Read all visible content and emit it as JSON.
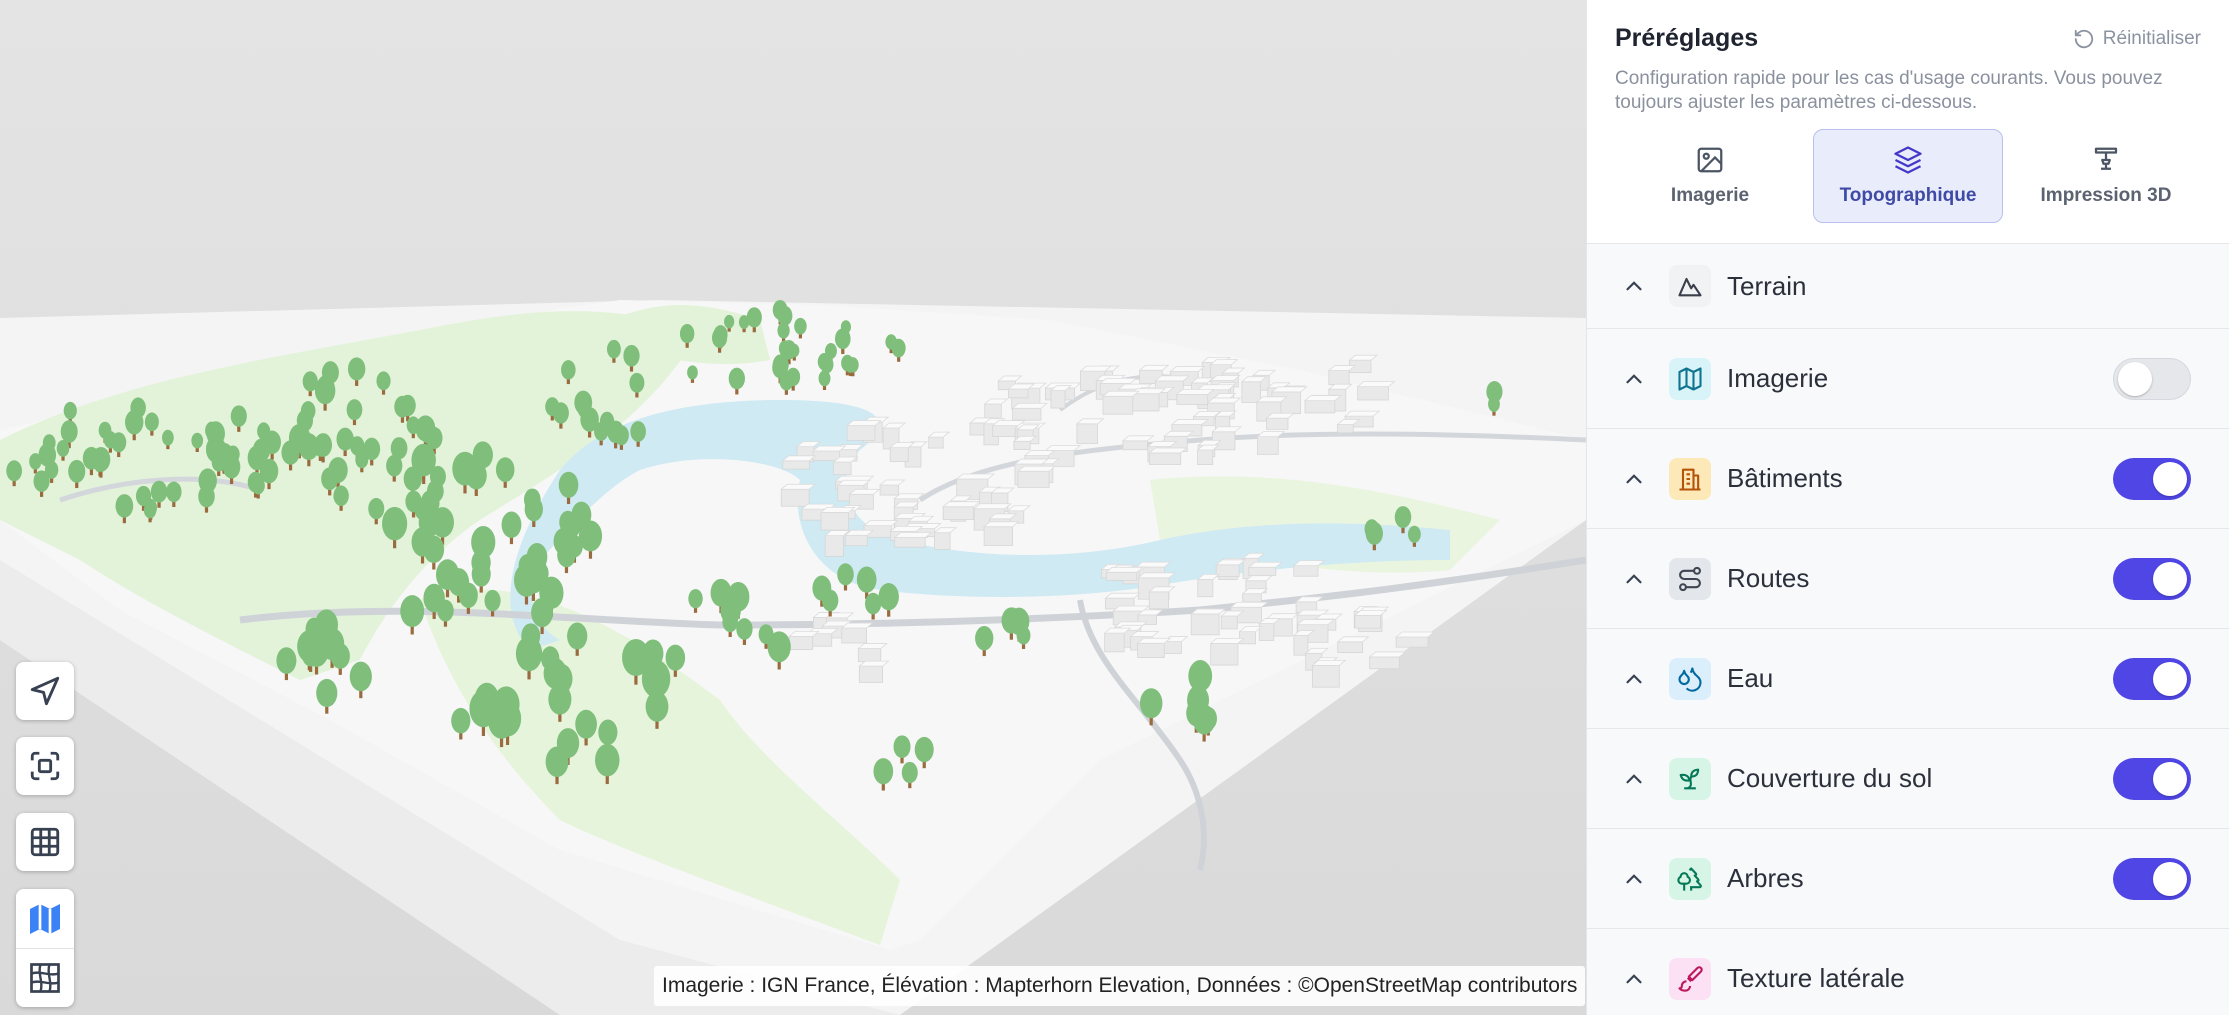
{
  "map": {
    "attribution": "Imagerie : IGN France, Élévation : Mapterhorn Elevation, Données : ©OpenStreetMap contributors",
    "controls": [
      {
        "name": "navigate-icon"
      },
      {
        "name": "fit-bounds-icon"
      },
      {
        "name": "grid-icon"
      },
      {
        "name": "map-view-icon",
        "active": true
      },
      {
        "name": "mesh-view-icon"
      }
    ]
  },
  "presets": {
    "title": "Préréglages",
    "reset_label": "Réinitialiser",
    "description": "Configuration rapide pour les cas d'usage courants. Vous pouvez toujours ajuster les paramètres ci-dessous.",
    "tabs": [
      {
        "label": "Imagerie",
        "icon": "image-icon",
        "active": false
      },
      {
        "label": "Topographique",
        "icon": "layers-icon",
        "active": true
      },
      {
        "label": "Impression 3D",
        "icon": "printer-3d-icon",
        "active": false
      }
    ]
  },
  "layers": [
    {
      "label": "Terrain",
      "icon": "mountain-icon",
      "icon_bg": "#f1f2f4",
      "icon_color": "#3a3f4b",
      "toggle": null
    },
    {
      "label": "Imagerie",
      "icon": "map-icon",
      "icon_bg": "#d8f4f8",
      "icon_color": "#0e7490",
      "toggle": false
    },
    {
      "label": "Bâtiments",
      "icon": "building-icon",
      "icon_bg": "#fde9b8",
      "icon_color": "#b45309",
      "toggle": true
    },
    {
      "label": "Routes",
      "icon": "route-icon",
      "icon_bg": "#e3e6ea",
      "icon_color": "#3f4652",
      "toggle": true
    },
    {
      "label": "Eau",
      "icon": "droplets-icon",
      "icon_bg": "#dbeefc",
      "icon_color": "#0369a1",
      "toggle": true
    },
    {
      "label": "Couverture du sol",
      "icon": "sprout-icon",
      "icon_bg": "#d7f5e6",
      "icon_color": "#047857",
      "toggle": true
    },
    {
      "label": "Arbres",
      "icon": "trees-icon",
      "icon_bg": "#d7f5e6",
      "icon_color": "#047857",
      "toggle": true
    },
    {
      "label": "Texture latérale",
      "icon": "paintbrush-icon",
      "icon_bg": "#fbe1f3",
      "icon_color": "#be185d",
      "toggle": null
    }
  ],
  "colors": {
    "accent": "#4f46e5",
    "tree_canopy": "#7fbf7b",
    "tree_trunk": "#9a6b3f",
    "water": "#cfeaf3",
    "vegetation": "#e3f3d9"
  }
}
